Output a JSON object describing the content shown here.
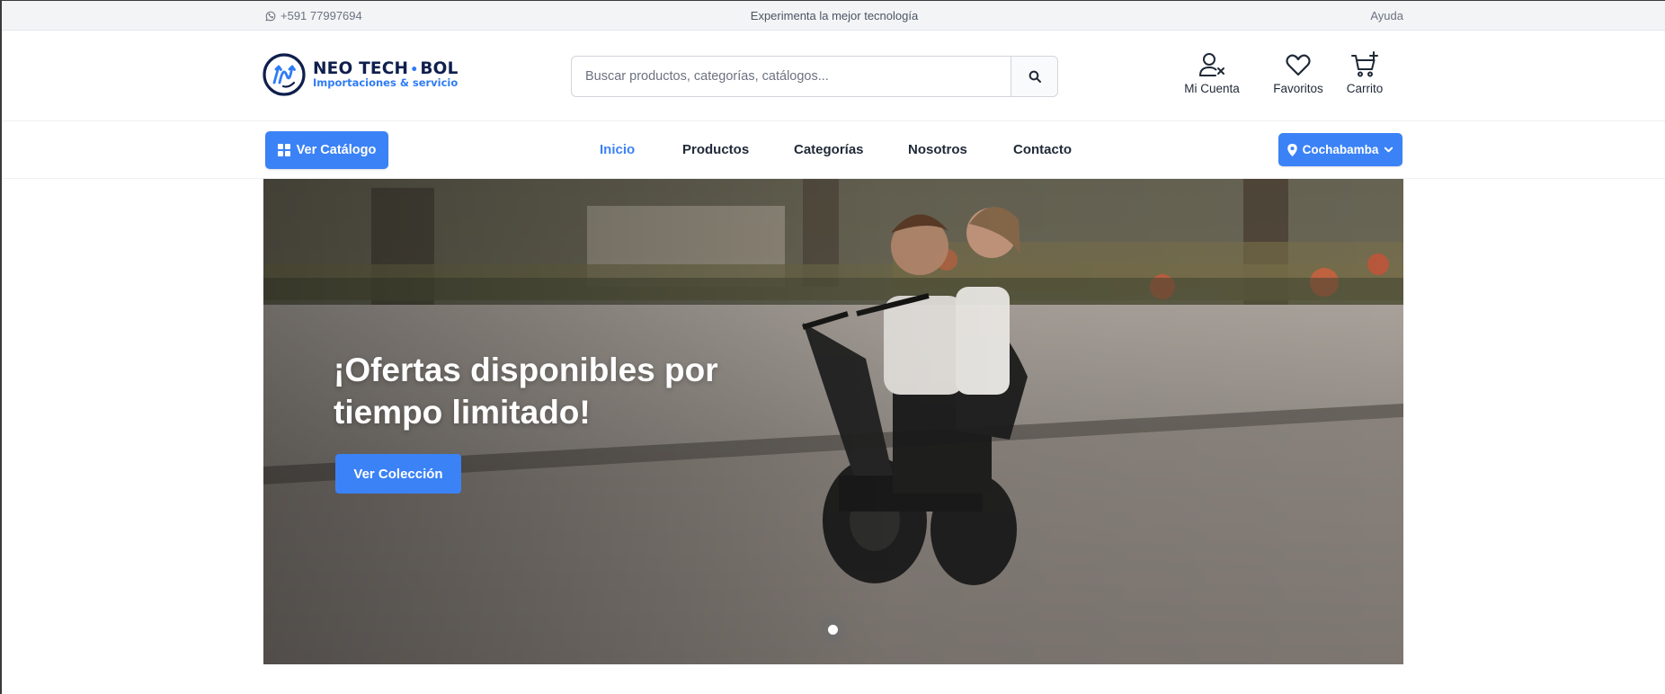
{
  "topbar": {
    "phone": "+591 77997694",
    "promo": "Experimenta la mejor tecnología",
    "help": "Ayuda"
  },
  "header": {
    "logo_name_left": "NEO TECH",
    "logo_dot": "•",
    "logo_name_right": "BOL",
    "logo_tagline": "Importaciones & servicio",
    "search_placeholder": "Buscar productos, categorías, catálogos...",
    "account_label": "Mi Cuenta",
    "favorites_label": "Favoritos",
    "cart_label": "Carrito"
  },
  "nav": {
    "catalog_label": "Ver Catálogo",
    "links": [
      "Inicio",
      "Productos",
      "Categorías",
      "Nosotros",
      "Contacto"
    ],
    "active_link": "Inicio",
    "city_label": "Cochabamba"
  },
  "hero": {
    "title": "¡Ofertas disponibles por tiempo limitado!",
    "cta_label": "Ver Colección",
    "slide_count": 1,
    "active_slide": 1
  },
  "colors": {
    "primary": "#3b82f6",
    "brand_navy": "#0f1f4d",
    "topbar_bg": "#f3f4f6"
  },
  "icons": {
    "phone": "whatsapp-icon",
    "search": "search-icon",
    "account": "user-x-icon",
    "favorites": "heart-icon",
    "cart": "cart-plus-icon",
    "catalog": "grid-icon",
    "city": "map-pin-icon",
    "city_dropdown": "chevron-down-icon"
  }
}
